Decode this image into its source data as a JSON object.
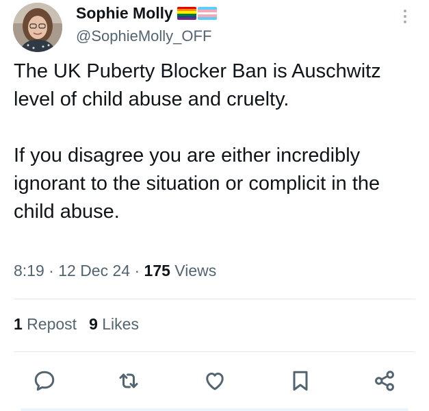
{
  "author": {
    "name": "Sophie Molly",
    "handle": "@SophieMolly_OFF",
    "flags": [
      "rainbow-flag",
      "transgender-flag"
    ]
  },
  "tweet": {
    "paragraph1": "The UK Puberty Blocker Ban is Auschwitz level of child abuse and cruelty.",
    "paragraph2": "If you disagree you are either incredibly ignorant to the situation or complicit in the child abuse."
  },
  "meta": {
    "time": "8:19",
    "separator1": " · ",
    "date": "12 Dec 24",
    "separator2": " · ",
    "views_count": "175",
    "views_label": " Views"
  },
  "stats": {
    "reposts_count": "1",
    "reposts_label": " Repost",
    "likes_count": "9",
    "likes_label": " Likes"
  },
  "actions": {
    "icons": [
      "reply-icon",
      "repost-icon",
      "like-icon",
      "bookmark-icon",
      "share-icon"
    ]
  },
  "colors": {
    "text_primary": "#0f1419",
    "text_secondary": "#536471",
    "icon": "#536471",
    "divider": "#e2e7eb"
  }
}
